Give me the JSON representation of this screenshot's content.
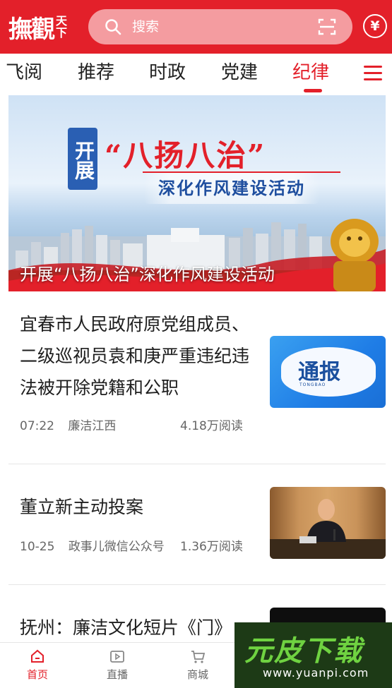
{
  "header": {
    "logo_main": "撫觀",
    "logo_top": "天",
    "logo_bottom": "下",
    "search_placeholder": "搜索",
    "wallet_symbol": "¥",
    "colors": {
      "brand_red": "#e3202a",
      "search_bg": "#f49ca0"
    }
  },
  "tabs": [
    {
      "label": "飞阅",
      "active": false
    },
    {
      "label": "推荐",
      "active": false
    },
    {
      "label": "时政",
      "active": false
    },
    {
      "label": "党建",
      "active": false
    },
    {
      "label": "纪律",
      "active": true
    }
  ],
  "banner": {
    "badge": "开展",
    "headline": "“八扬八治”",
    "subheadline": "深化作风建设活动",
    "caption": "开展“八扬八治”深化作风建设活动"
  },
  "news": [
    {
      "title": "宜春市人民政府原党组成员、二级巡视员袁和庚严重违纪违法被开除党籍和公职",
      "time": "07:22",
      "source": "廉洁江西",
      "reads": "4.18万阅读",
      "thumb_text": "通报",
      "thumb_sub": "TONGBAO"
    },
    {
      "title": "董立新主动投案",
      "time": "10-25",
      "source": "政事儿微信公众号",
      "reads": "1.36万阅读"
    },
    {
      "title": "抚州：廉洁文化短片《门》"
    }
  ],
  "bottom_nav": [
    {
      "label": "首页",
      "icon": "home-icon",
      "active": true
    },
    {
      "label": "直播",
      "icon": "live-icon",
      "active": false
    },
    {
      "label": "商城",
      "icon": "cart-icon",
      "active": false
    }
  ],
  "watermark": {
    "title": "元皮下载",
    "url": "www.yuanpi.com"
  }
}
